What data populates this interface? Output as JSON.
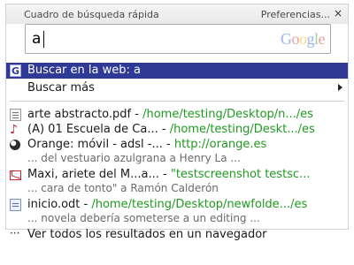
{
  "window": {
    "title": "Cuadro de búsqueda rápida",
    "preferences_label": "Preferencias...",
    "close_label": "×"
  },
  "search": {
    "value": "a",
    "provider_logo_text": [
      "G",
      "o",
      "o",
      "g",
      "l",
      "e"
    ]
  },
  "actions": [
    {
      "label": "Buscar en la web: a",
      "icon": "google-g-icon",
      "icon_text": "G",
      "selected": true
    },
    {
      "label": "Buscar más",
      "has_submenu": true
    }
  ],
  "results": [
    {
      "icon": "pdf-file-icon",
      "bold_prefix": "arte abstracto.pdf",
      "separator": " - ",
      "path": "/home/testing/Desktop/n.../es"
    },
    {
      "icon": "music-note-icon",
      "bold_prefix": "(A) 01 Escuela de Ca...",
      "separator": " - ",
      "path": "/home/testing/Deskt.../es"
    },
    {
      "icon": "orange-browser-icon",
      "bold_prefix": "Orange: móvil - adsl -...",
      "separator": " - ",
      "path": "http://orange.es",
      "snippet": "... del vestuario azulgrana a Henry La ..."
    },
    {
      "icon": "mail-icon",
      "bold_prefix": "Maxi, ariete del M...a...",
      "separator": " - ",
      "path": "\"testscreenshot testsc...",
      "snippet": "... cara de tonto\" a Ramón Calderón"
    },
    {
      "icon": "document-icon",
      "bold_prefix": "inicio.odt",
      "separator": " - ",
      "path": "/home/testing/Desktop/newfolde.../es",
      "snippet": "... novela debería someterse a un editing ..."
    }
  ],
  "footer_action": {
    "label": "Ver todos los resultados en un navegador",
    "icon_text": "···"
  }
}
